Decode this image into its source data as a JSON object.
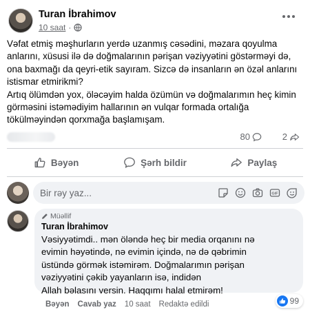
{
  "post": {
    "author": "Turan İbrahimov",
    "time": "10 saat",
    "paragraphs": [
      "Vəfat etmiş məşhurların yerdə uzanmış cəsədini, məzara qoyulma anlarını, xüsusi ilə də doğmalarının pərişan vəziyyətini göstərməyi də, ona baxmağı da qeyri-etik sayıram. Sizcə də insanların ən özəl anlarını istismar etmirikmi?",
      "Artıq ölümdən yox, öləcəyim halda özümün və doğmalarımın heç kimin görməsini istəmədiyim hallarının ən vulqar formada ortalığa tökülməyindən qorxmağa başlamışam."
    ],
    "comments_count": "80",
    "shares_count": "2"
  },
  "actions": {
    "like": "Bəyən",
    "comment": "Şərh bildir",
    "share": "Paylaş"
  },
  "composer": {
    "placeholder": "Bir rəy yaz..."
  },
  "comment": {
    "badge": "Müəllif",
    "author": "Turan İbrahimov",
    "lines": [
      "Vəsiyyətimdi.. mən öləndə heç bir media orqanını nə",
      "evimin həyətində, nə evimin içində, nə də qəbrimin",
      "üstündə görmək istəmirəm. Doğmalarımın pərişan",
      "vəziyyətini çəkib yayanların isə, indidən",
      "Allah bəlasını versin. Haqqımı halal etmirəm!"
    ],
    "like_label": "Bəyən",
    "reply_label": "Cavab yaz",
    "time": "10 saat",
    "edited": "Redaktə edildi",
    "reaction_count": "99"
  },
  "colors": {
    "accent": "#1877f2",
    "secondary_text": "#65676b",
    "bubble": "#f0f2f5"
  }
}
